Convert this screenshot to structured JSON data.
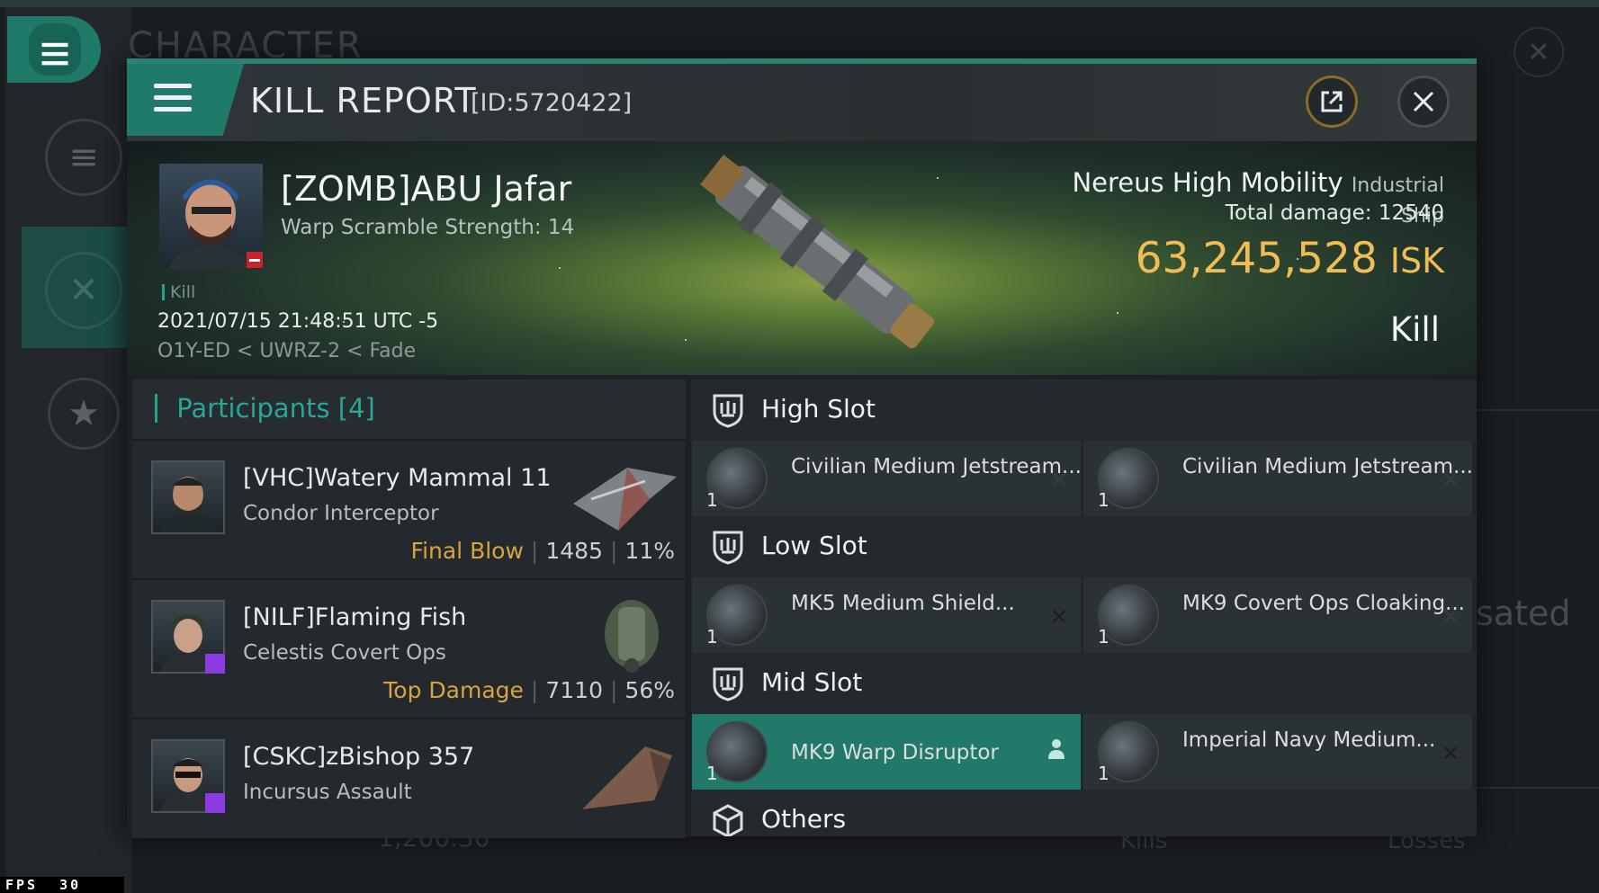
{
  "background": {
    "title": "CHARACTER",
    "right_text": "sated",
    "bottom_value": "1,200.30",
    "bottom_kills": "Kills",
    "bottom_losses": "Losses",
    "fps_label": "FPS",
    "fps_value": "30"
  },
  "header": {
    "title": "KILL REPORT",
    "id": "[ID:5720422]"
  },
  "victim": {
    "name": "[ZOMB]ABU Jafar",
    "warp_scramble": "Warp Scramble Strength: 14",
    "tag": "Kill",
    "date": "2021/07/15 21:48:51 UTC -5",
    "location": "O1Y-ED < UWRZ-2 < Fade"
  },
  "ship": {
    "name": "Nereus High Mobility",
    "class": "Industrial Ship",
    "total_damage_label": "Total damage:",
    "total_damage": "12540",
    "isk_value": "63,245,528",
    "isk_unit": "ISK",
    "result": "Kill"
  },
  "participants": {
    "title": "Participants",
    "count": "[4]",
    "items": [
      {
        "name": "[VHC]Watery Mammal 11",
        "ship": "Condor Interceptor",
        "label": "Final Blow",
        "damage": "1485",
        "percent": "11%"
      },
      {
        "name": "[NILF]Flaming Fish",
        "ship": "Celestis Covert Ops",
        "label": "Top Damage",
        "damage": "7110",
        "percent": "56%"
      },
      {
        "name": "[CSKC]zBishop 357",
        "ship": "Incursus Assault",
        "label": "",
        "damage": "",
        "percent": ""
      }
    ]
  },
  "slots": {
    "high": {
      "title": "High Slot",
      "items": [
        {
          "name": "Civilian Medium Jetstream...",
          "qty": "1"
        },
        {
          "name": "Civilian Medium Jetstream...",
          "qty": "1"
        }
      ]
    },
    "low": {
      "title": "Low Slot",
      "items": [
        {
          "name": "MK5 Medium Shield...",
          "qty": "1"
        },
        {
          "name": "MK9 Covert Ops Cloaking...",
          "qty": "1"
        }
      ]
    },
    "mid": {
      "title": "Mid Slot",
      "items": [
        {
          "name": "MK9 Warp Disruptor",
          "qty": "1"
        },
        {
          "name": "Imperial Navy Medium...",
          "qty": "1"
        }
      ]
    },
    "others": {
      "title": "Others"
    }
  },
  "colors": {
    "accent": "#1f7a6a",
    "isk": "#f0bc55",
    "highlight_label": "#d9a440",
    "teal_text": "#2aa596"
  }
}
